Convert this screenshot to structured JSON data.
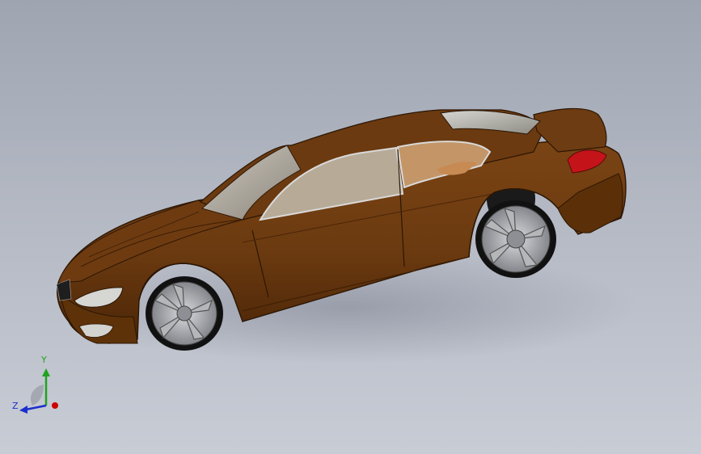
{
  "viewport": {
    "background_top": "#9ea5b1",
    "background_bottom": "#c8ccd5"
  },
  "model": {
    "body_color": "#6b3a10",
    "body_edge_color": "#2b1604",
    "glass_color": "#b9b7b0",
    "interior_color": "#c78a52",
    "taillight_color": "#c4141a",
    "rim_color": "#9a9ba0",
    "tire_color": "#111111"
  },
  "triad": {
    "y_label": "Y",
    "z_label": "Z",
    "x_axis_color": "#cc0000",
    "y_axis_color": "#1fa31f",
    "z_axis_color": "#1c2fcc"
  }
}
